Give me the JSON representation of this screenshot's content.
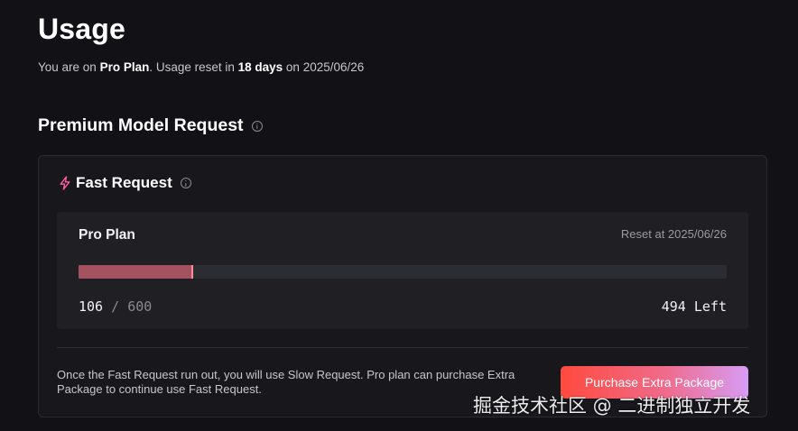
{
  "header": {
    "title": "Usage",
    "subtitle_prefix": "You are on ",
    "plan_name": "Pro Plan",
    "subtitle_mid": ". Usage reset in ",
    "reset_days": "18 days",
    "subtitle_on": " on ",
    "reset_date": "2025/06/26"
  },
  "section": {
    "title": "Premium Model Request",
    "icon": "info-icon"
  },
  "card": {
    "title": "Fast Request",
    "title_icon": "lightning-bolt-icon",
    "info_icon": "info-icon",
    "plan": {
      "name": "Pro Plan",
      "reset_label": "Reset at 2025/06/26",
      "used": "106",
      "separator": " / ",
      "total": "600",
      "left_label": "494 Left",
      "progress_fraction": 0.1767
    },
    "footnote": "Once the Fast Request run out, you will use Slow Request. Pro plan can purchase Extra Package to continue use Fast Request.",
    "purchase_label": "Purchase Extra Package"
  },
  "watermark": "掘金技术社区 @ 二进制独立开发",
  "colors": {
    "background": "#121216",
    "card": "#17171c",
    "panel": "#1f1f24",
    "progress_fill": "#a45260",
    "accent_pink": "#ff5fa2"
  }
}
